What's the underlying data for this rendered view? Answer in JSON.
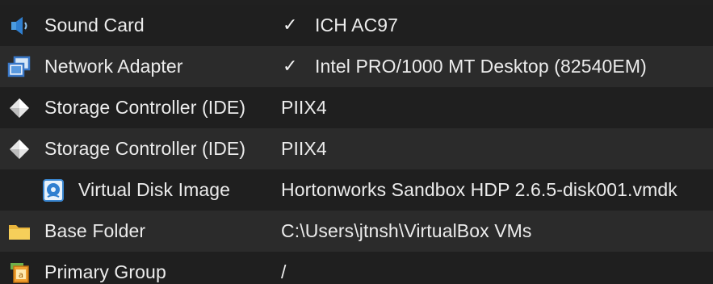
{
  "rows": [
    {
      "label": "Sound Card",
      "value": "ICH AC97",
      "checked": true,
      "icon": "speaker-icon"
    },
    {
      "label": "Network Adapter",
      "value": "Intel PRO/1000 MT Desktop (82540EM)",
      "checked": true,
      "icon": "network-adapter-icon"
    },
    {
      "label": "Storage Controller (IDE)",
      "value": "PIIX4",
      "checked": false,
      "icon": "storage-controller-icon"
    },
    {
      "label": "Storage Controller (IDE)",
      "value": "PIIX4",
      "checked": false,
      "icon": "storage-controller-icon"
    },
    {
      "label": "Virtual Disk Image",
      "value": "Hortonworks Sandbox HDP 2.6.5-disk001.vmdk",
      "checked": false,
      "icon": "virtual-disk-icon"
    },
    {
      "label": "Base Folder",
      "value": "C:\\Users\\jtnsh\\VirtualBox VMs",
      "checked": false,
      "icon": "folder-icon"
    },
    {
      "label": "Primary Group",
      "value": "/",
      "checked": false,
      "icon": "group-icon"
    }
  ],
  "check_mark": "✓"
}
